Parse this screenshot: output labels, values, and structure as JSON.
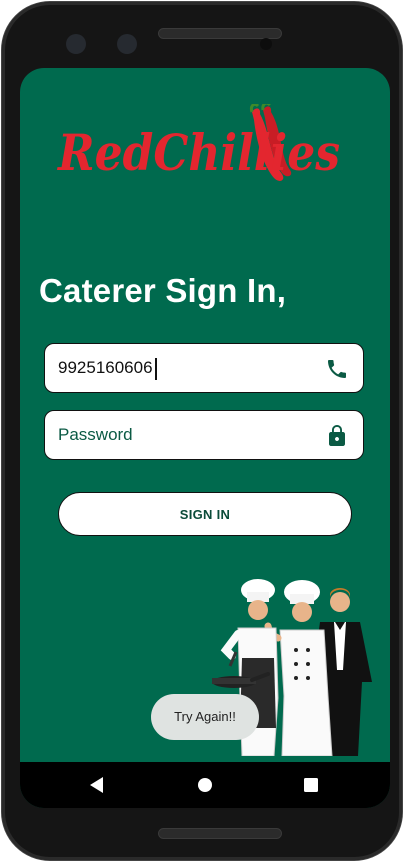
{
  "app": {
    "logo_text": "RedChillies",
    "brand_color": "#006a4e",
    "logo_color": "#e3262f"
  },
  "signin": {
    "heading": "Caterer Sign In,",
    "phone_value": "9925160606",
    "phone_icon": "phone-icon",
    "password_placeholder": "Password",
    "password_icon": "lock-icon",
    "button_label": "SIGN IN"
  },
  "toast": {
    "message": "Try Again!!"
  },
  "navbar": {
    "icons": [
      "back-icon",
      "home-icon",
      "recents-icon"
    ]
  }
}
